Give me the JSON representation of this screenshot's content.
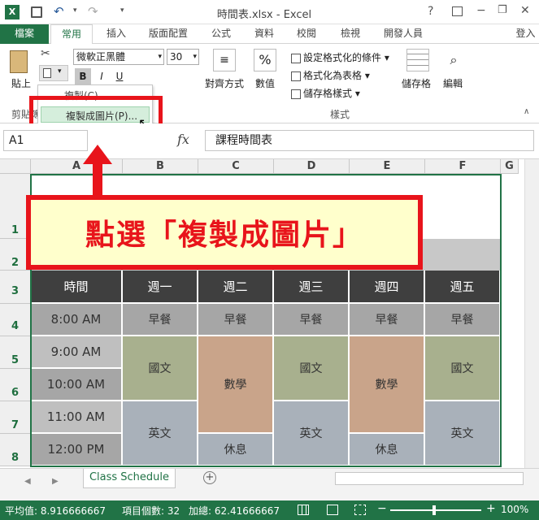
{
  "window": {
    "title": "時間表.xlsx - Excel",
    "help": "?",
    "min": "−",
    "restore": "❐",
    "close": "✕",
    "login": "登入"
  },
  "ribbon_tabs": [
    "檔案",
    "常用",
    "插入",
    "版面配置",
    "公式",
    "資料",
    "校閱",
    "檢視",
    "開發人員"
  ],
  "font": {
    "name": "微軟正黑體",
    "size": "30",
    "bold": "B",
    "italic": "I",
    "underline": "U"
  },
  "clipboard": {
    "paste": "貼上",
    "group": "剪貼簿"
  },
  "menu": {
    "copy": "複製(C)",
    "copy_picture": "複製成圖片(P)..."
  },
  "alignment_label": "對齊方式",
  "number_label": "數值",
  "pct": "%",
  "styles": {
    "cond": "設定格式化的條件",
    "table": "格式化為表格",
    "cell": "儲存格樣式",
    "group": "樣式"
  },
  "cells_label": "儲存格",
  "edit_label": "編輯",
  "namebox": "A1",
  "fx": "fx",
  "formula": "課程時間表",
  "columns": [
    "A",
    "B",
    "C",
    "D",
    "E",
    "F",
    "G"
  ],
  "rows": [
    "1",
    "2",
    "3",
    "4",
    "5",
    "6",
    "7",
    "8"
  ],
  "schedule": {
    "header": [
      "時間",
      "週一",
      "週二",
      "週三",
      "週四",
      "週五"
    ],
    "times": [
      "8:00 AM",
      "9:00 AM",
      "10:00 AM",
      "11:00 AM",
      "12:00 PM"
    ],
    "breakfast": "早餐",
    "chinese": "國文",
    "math": "數學",
    "english": "英文",
    "rest": "休息"
  },
  "callout": "點選「複製成圖片」",
  "sheet_tab": "Class Schedule",
  "status": {
    "avg": "平均值: 8.916666667",
    "count": "項目個數: 32",
    "sum": "加總: 62.41666667",
    "zoom": "100%"
  },
  "colors": {
    "excel_green": "#217346",
    "callout_red": "#e8141b",
    "callout_bg": "#ffffcc"
  }
}
